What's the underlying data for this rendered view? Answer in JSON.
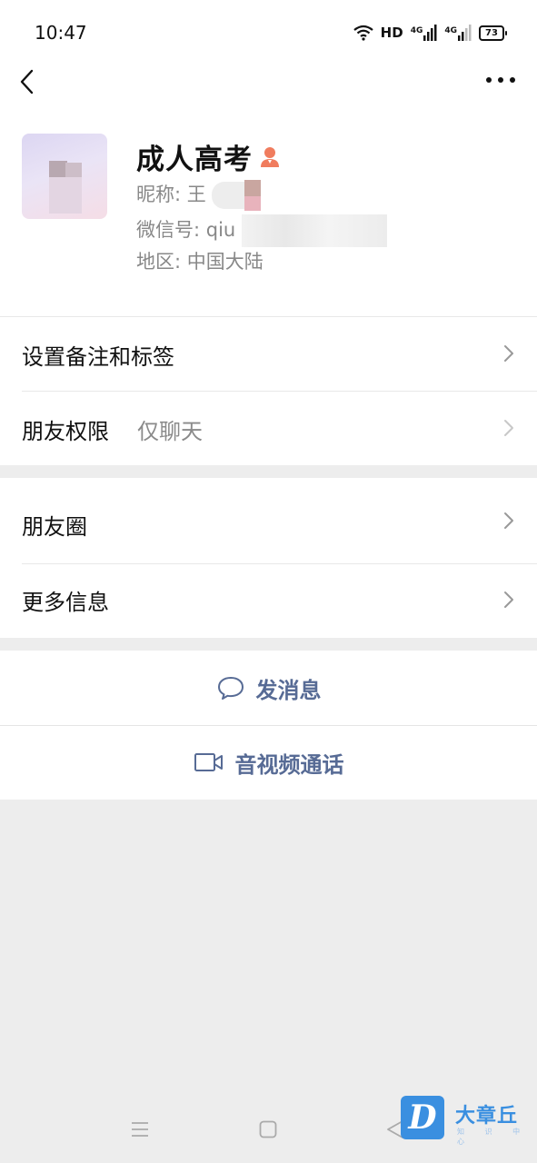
{
  "status_bar": {
    "time": "10:47",
    "network": "HD",
    "signal1": "4G",
    "signal2": "4G",
    "battery": "73"
  },
  "profile": {
    "name": "成人高考",
    "nickname_label": "昵称:",
    "nickname_value": "王",
    "wechat_id_label": "微信号:",
    "wechat_id_value": "qiu",
    "region_label": "地区:",
    "region_value": "中国大陆"
  },
  "settings": {
    "remark_tags": "设置备注和标签",
    "friend_permissions": "朋友权限",
    "friend_permissions_value": "仅聊天"
  },
  "more_section": {
    "moments": "朋友圈",
    "more_info": "更多信息"
  },
  "actions": {
    "send_message": "发消息",
    "video_call": "音视频通话"
  },
  "watermark": {
    "logo_letter": "D",
    "name": "大章丘",
    "sub": "知 识 中 心"
  },
  "colors": {
    "link_blue": "#576b95",
    "background": "#ededed",
    "person_badge": "#f07c5e"
  }
}
